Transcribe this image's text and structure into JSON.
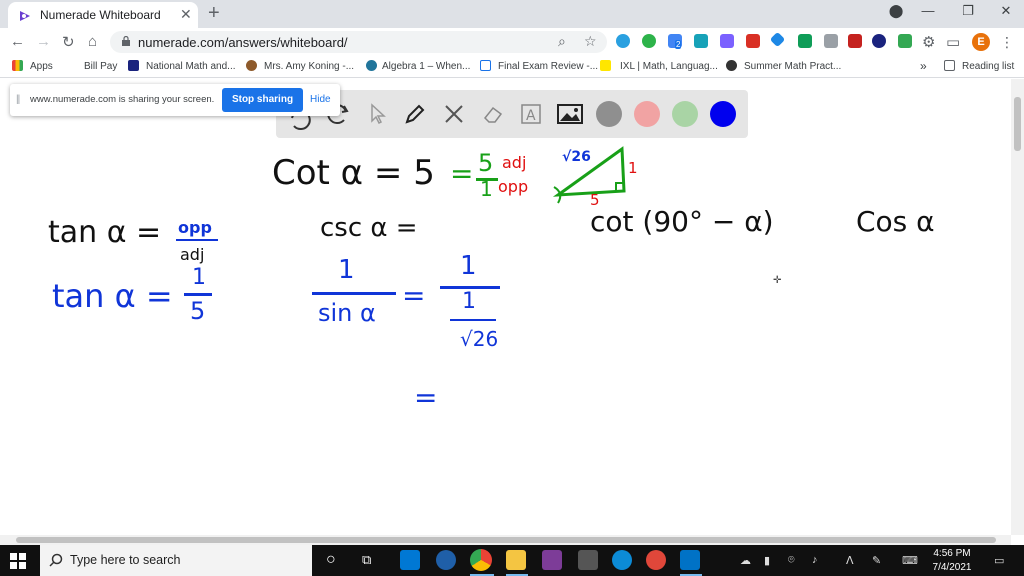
{
  "browser": {
    "tab_title": "Numerade Whiteboard",
    "tab_close": "✕",
    "new_tab": "+",
    "url": "numerade.com/answers/whiteboard/",
    "profile_initial": "E",
    "extension_badge": "2"
  },
  "bookmarks": [
    {
      "label": "Apps"
    },
    {
      "label": "Bill Pay"
    },
    {
      "label": "National Math and..."
    },
    {
      "label": "Mrs. Amy Koning -..."
    },
    {
      "label": "Algebra 1 – When..."
    },
    {
      "label": "Final Exam Review -..."
    },
    {
      "label": "IXL | Math, Languag..."
    },
    {
      "label": "Summer Math Pract..."
    },
    {
      "label": "»"
    },
    {
      "label": "Reading list"
    }
  ],
  "share_bar": {
    "message": "www.numerade.com is sharing your screen.",
    "stop_label": "Stop sharing",
    "hide_label": "Hide"
  },
  "whiteboard": {
    "toolbar_colors": [
      "#8f8f8f",
      "#f1a3a3",
      "#a9d4a5",
      "#0000ee"
    ],
    "ink_colors": {
      "black": "#111111",
      "blue": "#1035d8",
      "green": "#18a018",
      "red": "#e01010"
    },
    "eq1": {
      "lhs": "Cot α = 5",
      "eq_green": "=",
      "num": "5",
      "den": "1",
      "num_label": "adj",
      "den_label": "opp"
    },
    "triangle": {
      "hyp": "√26",
      "opp": "1",
      "adj": "5"
    },
    "tan_def": {
      "lhs": "tan α =",
      "num": "opp",
      "den": "adj"
    },
    "tan_val": {
      "lhs": "tan α =",
      "num": "1",
      "den": "5"
    },
    "csc": {
      "lhs": "csc α =",
      "frac_num": "1",
      "frac_den": "sin α",
      "eq": "=",
      "num": "1",
      "inner_num": "1",
      "inner_den": "√26",
      "eq2": "="
    },
    "cot_compl": "cot (90° − α)",
    "cos": "Cos α"
  },
  "taskbar": {
    "search_placeholder": "Type here to search",
    "time": "4:56 PM",
    "date": "7/4/2021"
  }
}
